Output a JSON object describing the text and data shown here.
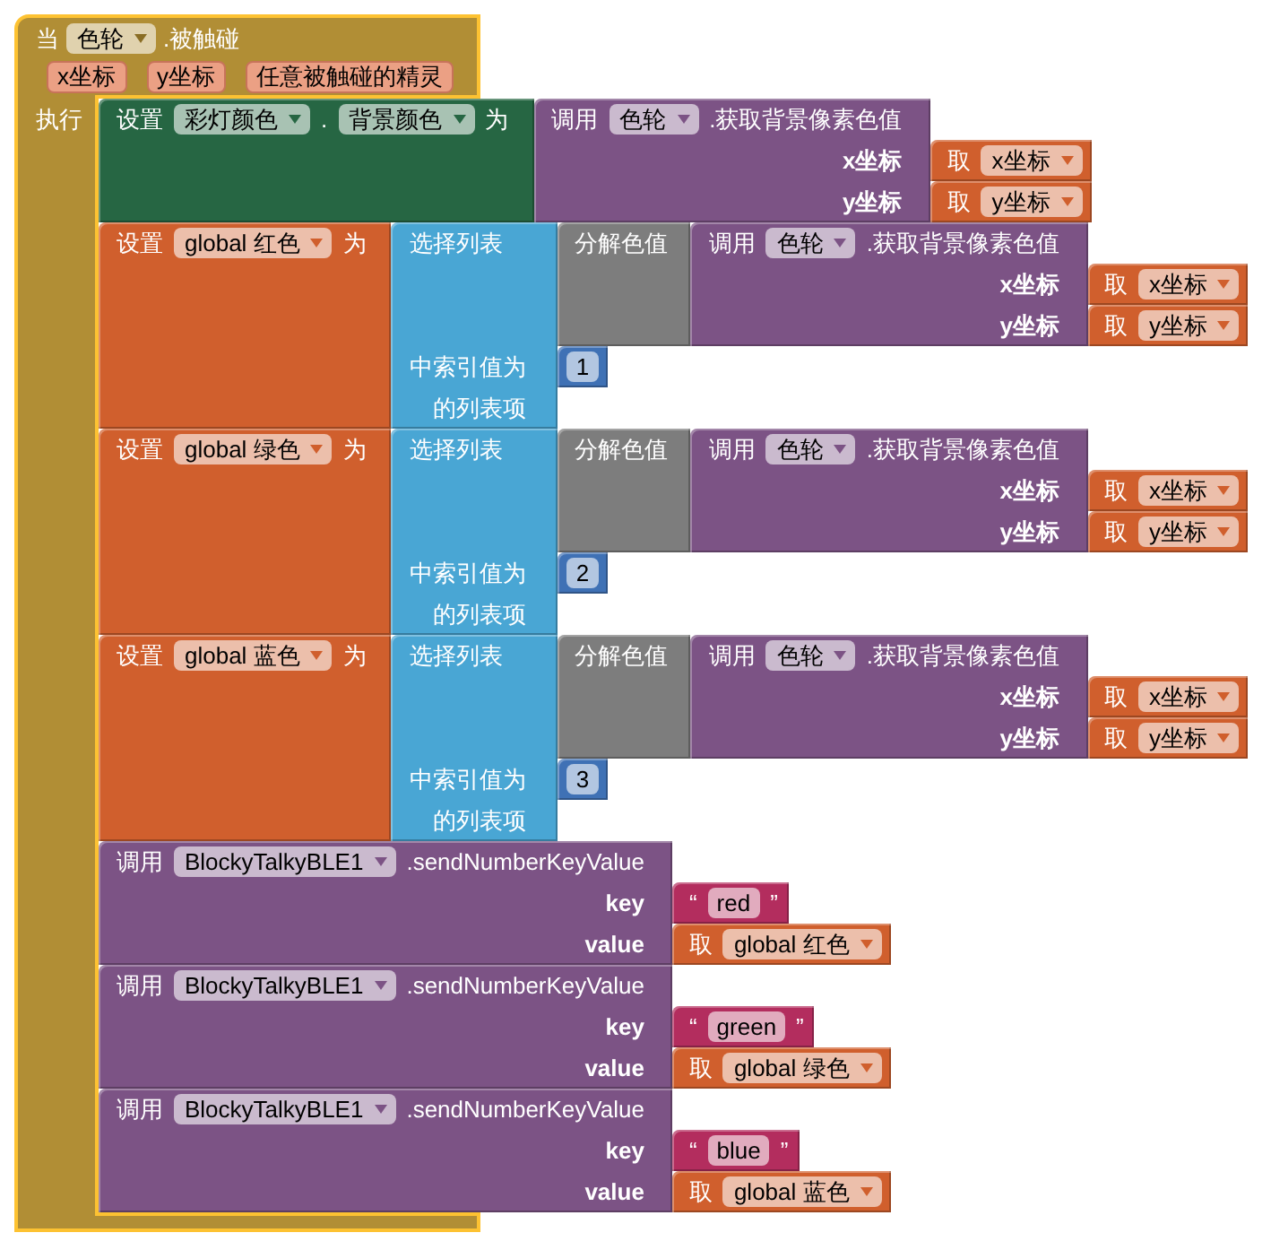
{
  "event_block": {
    "selected": true,
    "prefix": "当",
    "component": "色轮",
    "event_name": ".被触碰",
    "params": [
      "x坐标",
      "y坐标",
      "任意被触碰的精灵"
    ],
    "do_label": "执行",
    "statements": [
      {
        "kind": "set_property",
        "label": "设置",
        "component": "彩灯颜色",
        "dot": ".",
        "property": "背景颜色",
        "to_label": "为",
        "value": {
          "kind": "method_call",
          "label": "调用",
          "component": "色轮",
          "method": ".获取背景像素色值",
          "args": [
            {
              "name": "x坐标",
              "value": {
                "kind": "get",
                "label": "取",
                "variable": "x坐标"
              }
            },
            {
              "name": "y坐标",
              "value": {
                "kind": "get",
                "label": "取",
                "variable": "y坐标"
              }
            }
          ]
        }
      },
      {
        "kind": "set_global",
        "label": "设置",
        "variable": "global 红色",
        "to_label": "为",
        "value": {
          "kind": "list_select",
          "label": "选择列表",
          "index_label": "中索引值为",
          "suffix": "的列表项",
          "list": {
            "kind": "split_color",
            "label": "分解色值",
            "value": {
              "kind": "method_call",
              "label": "调用",
              "component": "色轮",
              "method": ".获取背景像素色值",
              "args": [
                {
                  "name": "x坐标",
                  "value": {
                    "kind": "get",
                    "label": "取",
                    "variable": "x坐标"
                  }
                },
                {
                  "name": "y坐标",
                  "value": {
                    "kind": "get",
                    "label": "取",
                    "variable": "y坐标"
                  }
                }
              ]
            }
          },
          "index": {
            "kind": "number",
            "text": "1"
          }
        }
      },
      {
        "kind": "set_global",
        "label": "设置",
        "variable": "global 绿色",
        "to_label": "为",
        "value": {
          "kind": "list_select",
          "label": "选择列表",
          "index_label": "中索引值为",
          "suffix": "的列表项",
          "list": {
            "kind": "split_color",
            "label": "分解色值",
            "value": {
              "kind": "method_call",
              "label": "调用",
              "component": "色轮",
              "method": ".获取背景像素色值",
              "args": [
                {
                  "name": "x坐标",
                  "value": {
                    "kind": "get",
                    "label": "取",
                    "variable": "x坐标"
                  }
                },
                {
                  "name": "y坐标",
                  "value": {
                    "kind": "get",
                    "label": "取",
                    "variable": "y坐标"
                  }
                }
              ]
            }
          },
          "index": {
            "kind": "number",
            "text": "2"
          }
        }
      },
      {
        "kind": "set_global",
        "label": "设置",
        "variable": "global 蓝色",
        "to_label": "为",
        "value": {
          "kind": "list_select",
          "label": "选择列表",
          "index_label": "中索引值为",
          "suffix": "的列表项",
          "list": {
            "kind": "split_color",
            "label": "分解色值",
            "value": {
              "kind": "method_call",
              "label": "调用",
              "component": "色轮",
              "method": ".获取背景像素色值",
              "args": [
                {
                  "name": "x坐标",
                  "value": {
                    "kind": "get",
                    "label": "取",
                    "variable": "x坐标"
                  }
                },
                {
                  "name": "y坐标",
                  "value": {
                    "kind": "get",
                    "label": "取",
                    "variable": "y坐标"
                  }
                }
              ]
            }
          },
          "index": {
            "kind": "number",
            "text": "3"
          }
        }
      },
      {
        "kind": "method_call",
        "label": "调用",
        "component": "BlockyTalkyBLE1",
        "method": ".sendNumberKeyValue",
        "args": [
          {
            "name": "key",
            "value": {
              "kind": "text",
              "open": "“",
              "text": "red",
              "close": "”"
            }
          },
          {
            "name": "value",
            "value": {
              "kind": "get",
              "label": "取",
              "variable": "global 红色"
            }
          }
        ]
      },
      {
        "kind": "method_call",
        "label": "调用",
        "component": "BlockyTalkyBLE1",
        "method": ".sendNumberKeyValue",
        "args": [
          {
            "name": "key",
            "value": {
              "kind": "text",
              "open": "“",
              "text": "green",
              "close": "”"
            }
          },
          {
            "name": "value",
            "value": {
              "kind": "get",
              "label": "取",
              "variable": "global 绿色"
            }
          }
        ]
      },
      {
        "kind": "method_call",
        "label": "调用",
        "component": "BlockyTalkyBLE1",
        "method": ".sendNumberKeyValue",
        "args": [
          {
            "name": "key",
            "value": {
              "kind": "text",
              "open": "“",
              "text": "blue",
              "close": "”"
            }
          },
          {
            "name": "value",
            "value": {
              "kind": "get",
              "label": "取",
              "variable": "global 蓝色"
            }
          }
        ]
      }
    ]
  }
}
